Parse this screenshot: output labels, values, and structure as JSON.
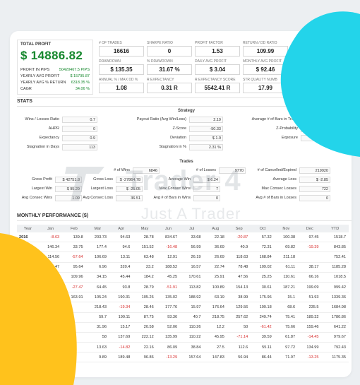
{
  "colors": {
    "accent_green": "#17882e",
    "negative_red": "#d83030",
    "cyan_blob": "#23d4ea",
    "yellow_blob": "#ffc21c"
  },
  "summary": {
    "total_profit_label": "TOTAL PROFIT",
    "total_profit_value": "$ 14886.82",
    "rows": [
      {
        "label": "PROFIT IN PIPS",
        "value": "50420467.5 PIPS"
      },
      {
        "label": "YEARLY AVG PROFIT",
        "value": "$ 15795.87"
      },
      {
        "label": "YEARLY AVG % RETURN",
        "value": "6318.35 %"
      },
      {
        "label": "CAGR",
        "value": "34.06 %"
      }
    ]
  },
  "metrics": [
    {
      "label": "# OF TRADES",
      "value": "16616"
    },
    {
      "label": "SHARPE RATIO",
      "value": "0"
    },
    {
      "label": "PROFIT FACTOR",
      "value": "1.53"
    },
    {
      "label": "RETURN / DD RATIO",
      "value": "109.99"
    },
    {
      "label": "DRAWDOWN",
      "value": "$ 135.35"
    },
    {
      "label": "% DRAWDOWN",
      "value": "31.67 %"
    },
    {
      "label": "DAILY AVG PROFIT",
      "value": "$ 3.04"
    },
    {
      "label": "MONTHLY AVG PROFIT",
      "value": "$ 92.46"
    },
    {
      "label": "ANNUAL % / MAX DD %",
      "value": "1.08"
    },
    {
      "label": "R EXPECTANCY",
      "value": "0.31 R"
    },
    {
      "label": "R EXPECTANCY SCORE",
      "value": "5542.41 R"
    },
    {
      "label": "STR QUALITY NUMB",
      "value": "17.99"
    }
  ],
  "stats": {
    "title": "STATS",
    "strategy_title": "Strategy",
    "col1": [
      {
        "k": "Wins / Losses Ratio",
        "v": "0.7"
      },
      {
        "k": "AHPR",
        "v": "0"
      },
      {
        "k": "Expectancy",
        "v": "0.9"
      },
      {
        "k": "Stagnation in Days",
        "v": "113"
      }
    ],
    "col2": [
      {
        "k": "Payout Ratio (Avg Win/Loss)",
        "v": "2.19"
      },
      {
        "k": "Z-Score",
        "v": "-50.33"
      },
      {
        "k": "Deviation",
        "v": "$ 1.9"
      },
      {
        "k": "Stagnation in %",
        "v": "2.31 %"
      }
    ],
    "col3": [
      {
        "k": "Average # of Bars in Trade",
        "v": ""
      },
      {
        "k": "Z-Probability",
        "v": ""
      },
      {
        "k": "Exposure",
        "v": ""
      }
    ]
  },
  "trades": {
    "title": "Trades",
    "top": [
      {
        "k": "# of Wins",
        "v": "6846"
      },
      {
        "k": "# of Losses",
        "v": "9770"
      },
      {
        "k": "# of Cancelled/Expired",
        "v": "219920"
      }
    ],
    "rows": [
      [
        {
          "k": "Gross Profit",
          "v": "$ 42751.8"
        },
        {
          "k": "Gross Loss",
          "v": "$ -27864.78"
        },
        {
          "k": "Average Win",
          "v": "$ 6.24"
        },
        {
          "k": "Average Loss",
          "v": "$ -2.85"
        }
      ],
      [
        {
          "k": "Largest Win",
          "v": "$ 95.29"
        },
        {
          "k": "Largest Loss",
          "v": "$ -25.05"
        },
        {
          "k": "Max Consec Wins",
          "v": "7"
        },
        {
          "k": "Max Consec Losses",
          "v": "722"
        }
      ],
      [
        {
          "k": "Avg Consec Wins",
          "v": "1.09"
        },
        {
          "k": "Avg Consec Loss",
          "v": "36.51"
        },
        {
          "k": "Avg # of Bars in Wins",
          "v": "0"
        },
        {
          "k": "Avg # of Bars in Losses",
          "v": "0"
        }
      ]
    ]
  },
  "watermark": {
    "brand": "Trader 4",
    "tagline": "Just A Trader"
  },
  "monthly": {
    "title": "MONTHLY PERFORMANCE ($)",
    "headers": [
      "Year",
      "Jan",
      "Feb",
      "Mar",
      "Apr",
      "May",
      "Jun",
      "Jul",
      "Aug",
      "Sep",
      "Oct",
      "Nov",
      "Dec",
      "YTD"
    ],
    "rows": [
      [
        "2016",
        "-8.63",
        "139.8",
        "203.73",
        "94.63",
        "28.78",
        "834.67",
        "33.68",
        "22.18",
        "-20.87",
        "57.32",
        "100.38",
        "97.45",
        "1518.7"
      ],
      [
        "2015",
        "146.34",
        "33.75",
        "177.4",
        "94.6",
        "151.52",
        "-16.48",
        "56.99",
        "36.69",
        "40.9",
        "72.31",
        "69.82",
        "-19.39",
        "843.85"
      ],
      [
        "2014",
        "114.56",
        "-57.64",
        "106.69",
        "13.11",
        "63.48",
        "12.91",
        "26.19",
        "26.69",
        "118.63",
        "168.84",
        "211.18",
        "",
        "752.41"
      ],
      [
        "2013",
        "142.47",
        "95.64",
        "6.96",
        "320.4",
        "23.2",
        "188.52",
        "16.57",
        "22.74",
        "78.48",
        "109.02",
        "61.11",
        "38.17",
        "1185.28"
      ],
      [
        "",
        "153.4",
        "109.96",
        "34.15",
        "45.44",
        "184.2",
        "45.25",
        "170.61",
        "25.91",
        "47.56",
        "25.25",
        "110.61",
        "66.16",
        "1018.5"
      ],
      [
        "",
        "98.21",
        "-27.47",
        "64.45",
        "93.8",
        "28.79",
        "-51.91",
        "113.82",
        "100.89",
        "154.13",
        "30.61",
        "187.21",
        "199.09",
        "999.42"
      ],
      [
        "",
        "75.53",
        "163.91",
        "105.24",
        "190.31",
        "105.26",
        "135.02",
        "188.92",
        "63.19",
        "38.99",
        "175.96",
        "15.1",
        "51.93",
        "1339.36"
      ],
      [
        "",
        "",
        "",
        "218.43",
        "-19.34",
        "28.46",
        "177.76",
        "15.97",
        "176.64",
        "129.56",
        "199.18",
        "68.6",
        "235.5",
        "1684.98"
      ],
      [
        "",
        "",
        "",
        "59.7",
        "199.11",
        "87.75",
        "93.36",
        "40.7",
        "218.75",
        "257.62",
        "249.74",
        "75.41",
        "189.32",
        "1780.86"
      ],
      [
        "",
        "",
        "",
        "31.96",
        "15.17",
        "20.58",
        "52.06",
        "110.26",
        "12.2",
        "50",
        "-61.42",
        "75.66",
        "159.46",
        "641.22"
      ],
      [
        "",
        "",
        "",
        "58",
        "137.69",
        "222.12",
        "135.99",
        "110.22",
        "45.95",
        "-71.14",
        "39.59",
        "61.87",
        "-14.45",
        "979.67"
      ],
      [
        "",
        "",
        "",
        "13.63",
        "-14.82",
        "22.16",
        "86.09",
        "38.84",
        "27.5",
        "112.6",
        "55.11",
        "97.72",
        "134.99",
        "792.43"
      ],
      [
        "",
        "",
        "",
        "9.89",
        "189.48",
        "96.86",
        "-13.29",
        "157.64",
        "147.83",
        "56.94",
        "86.44",
        "71.97",
        "-13.25",
        "1175.35"
      ]
    ]
  }
}
